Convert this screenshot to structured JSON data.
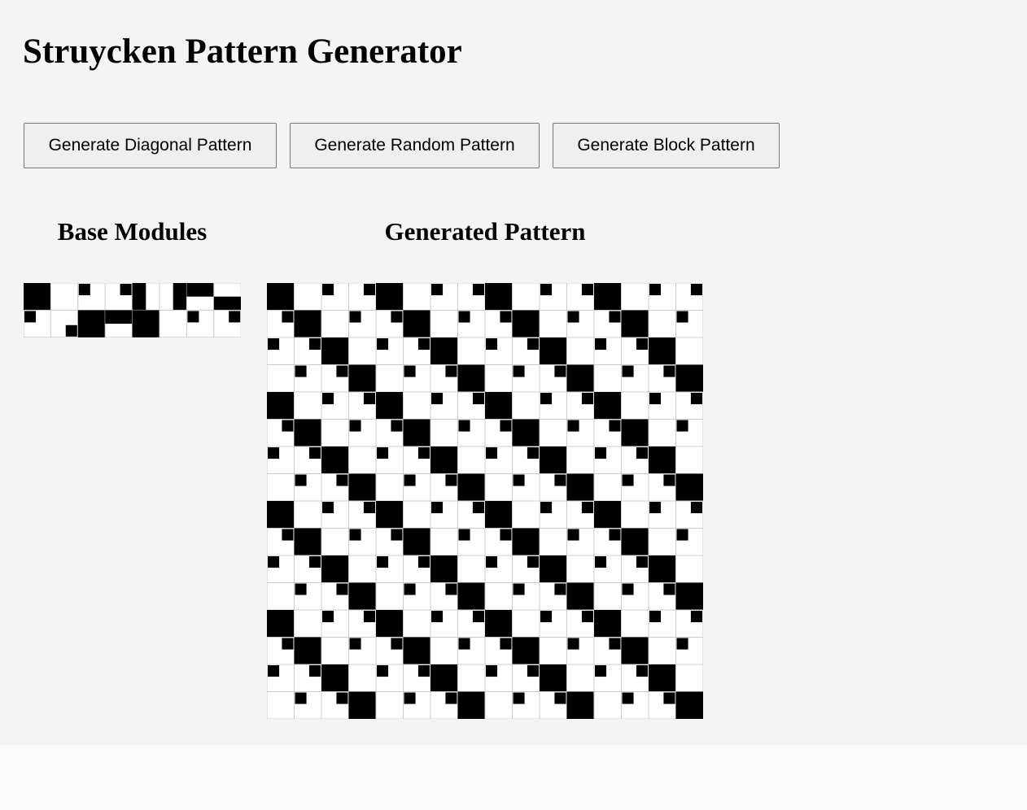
{
  "page": {
    "title": "Struycken Pattern Generator"
  },
  "buttons": {
    "diagonal_label": "Generate Diagonal Pattern",
    "random_label": "Generate Random Pattern",
    "block_label": "Generate Block Pattern"
  },
  "sections": {
    "base_title": "Base Modules",
    "generated_title": "Generated Pattern"
  },
  "colors": {
    "background": "#f4f4f4",
    "cell_background": "#ffffff",
    "fill": "#000000",
    "grid_line": "#cccccc"
  },
  "base_modules": [
    "full",
    "empty",
    "tl",
    "tr",
    "left",
    "right",
    "top",
    "bottom",
    "tl",
    "br",
    "full",
    "top"
  ],
  "generated_pattern": {
    "rows": 16,
    "cols": 16,
    "cycle": [
      "full",
      "empty",
      "tl",
      "tr"
    ],
    "row_shift": 1
  }
}
